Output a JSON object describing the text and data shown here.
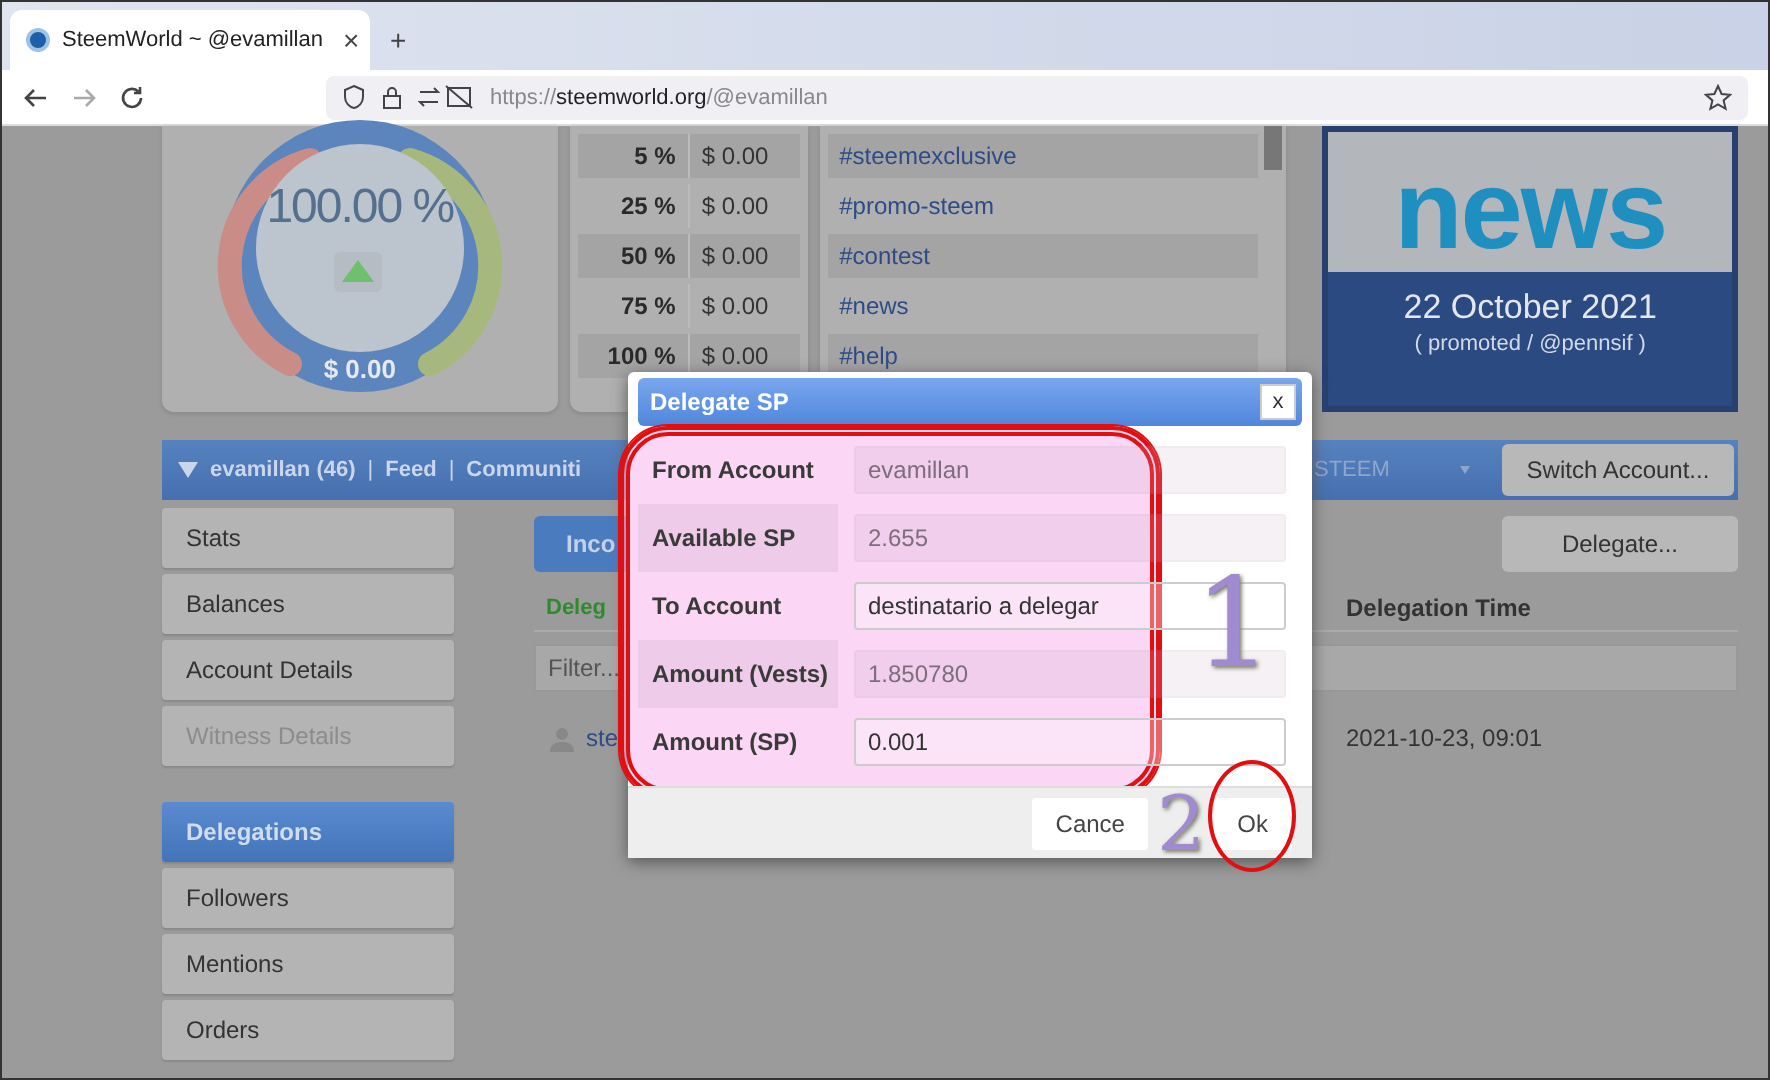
{
  "browser": {
    "tab": {
      "title": "SteemWorld ~ @evamillan",
      "close": "×"
    },
    "new_tab": "+",
    "url": {
      "scheme": "https://",
      "domain": "steemworld.org",
      "path": "/@evamillan"
    }
  },
  "gauge": {
    "percent": "100.00 %",
    "value": "$ 0.00"
  },
  "vote_table": [
    {
      "percent": "5 %",
      "value": "$ 0.00"
    },
    {
      "percent": "25 %",
      "value": "$ 0.00"
    },
    {
      "percent": "50 %",
      "value": "$ 0.00"
    },
    {
      "percent": "75 %",
      "value": "$ 0.00"
    },
    {
      "percent": "100 %",
      "value": "$ 0.00"
    }
  ],
  "tags": [
    "#steemexclusive",
    "#promo-steem",
    "#contest",
    "#news",
    "#help"
  ],
  "news_banner": {
    "headline": "news",
    "date": "22 October 2021",
    "credit": "( promoted / @pennsif )"
  },
  "nav": {
    "items": [
      "evamillan (46)",
      "Feed",
      "Communiti"
    ],
    "separator": "|",
    "currency": "STEEM",
    "switch_button": "Switch Account..."
  },
  "sidebar": {
    "groups": [
      [
        {
          "label": "Stats",
          "selected": false,
          "disabled": false
        },
        {
          "label": "Balances",
          "selected": false,
          "disabled": false
        },
        {
          "label": "Account Details",
          "selected": false,
          "disabled": false
        },
        {
          "label": "Witness Details",
          "selected": false,
          "disabled": true
        }
      ],
      [
        {
          "label": "Delegations",
          "selected": true,
          "disabled": false
        },
        {
          "label": "Followers",
          "selected": false,
          "disabled": false
        },
        {
          "label": "Mentions",
          "selected": false,
          "disabled": false
        },
        {
          "label": "Orders",
          "selected": false,
          "disabled": false
        }
      ]
    ]
  },
  "content": {
    "tab": "Inco",
    "delegate_button": "Delegate...",
    "columns": [
      "Deleg",
      "Delegation Time"
    ],
    "filter_placeholder": "Filter...",
    "row": {
      "user": "ste",
      "time": "2021-10-23, 09:01"
    }
  },
  "dialog": {
    "title": "Delegate SP",
    "close": "x",
    "fields": [
      {
        "label": "From Account",
        "value": "evamillan",
        "disabled": true
      },
      {
        "label": "Available SP",
        "value": "2.655",
        "disabled": true
      },
      {
        "label": "To Account",
        "value": "destinatario a delegar",
        "disabled": false
      },
      {
        "label": "Amount (Vests)",
        "value": "1.850780",
        "disabled": true
      },
      {
        "label": "Amount (SP)",
        "value": "0.001",
        "disabled": false
      }
    ],
    "cancel": "Cance",
    "ok": "Ok"
  },
  "annotations": [
    "1",
    "2"
  ]
}
